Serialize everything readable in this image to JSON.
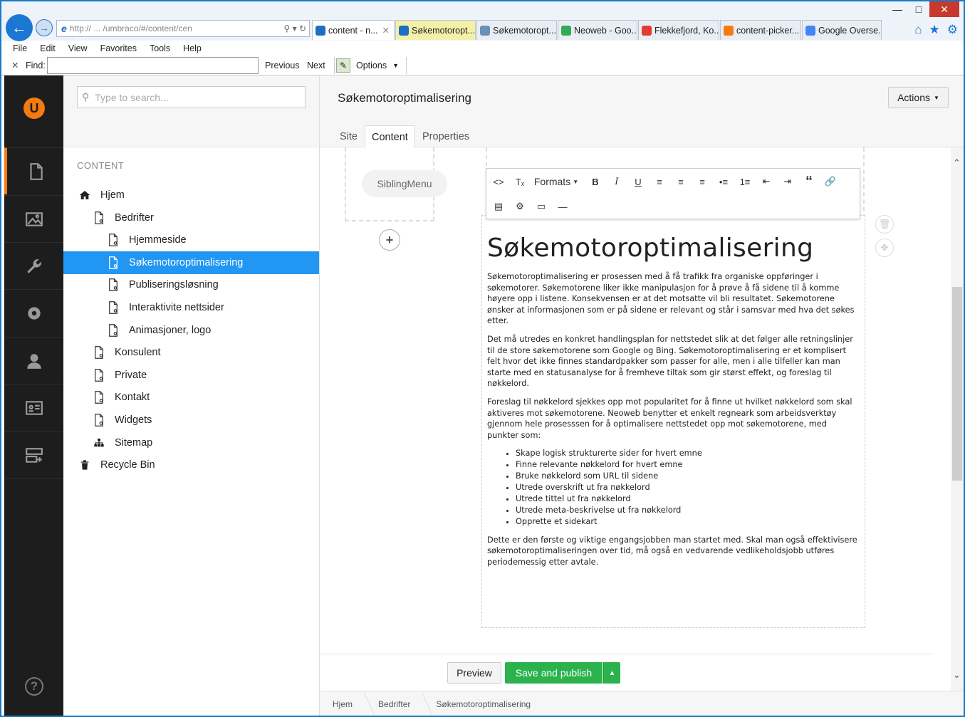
{
  "browser": {
    "address": "http:// ... /umbraco/#/content/cen",
    "tabs": [
      {
        "label": "content - n...",
        "active": true,
        "color": "#1e6fc4"
      },
      {
        "label": "Søkemotoropt...",
        "highlight": true,
        "color": "#1e6fc4"
      },
      {
        "label": "Søkemotoropt...",
        "color": "#6b8fb8"
      },
      {
        "label": "Neoweb - Goo...",
        "color": "#34a853"
      },
      {
        "label": "Flekkefjord, Ko...",
        "color": "#e53935"
      },
      {
        "label": "content-picker...",
        "color": "#f57a0f"
      },
      {
        "label": "Google Overse...",
        "color": "#4285f4"
      }
    ],
    "menu": [
      "File",
      "Edit",
      "View",
      "Favorites",
      "Tools",
      "Help"
    ],
    "find": {
      "label": "Find:",
      "value": "",
      "previous": "Previous",
      "next": "Next",
      "options": "Options"
    }
  },
  "sections": [
    "content-icon",
    "media-icon",
    "developer-icon",
    "settings-icon",
    "users-icon",
    "members-icon",
    "forms-icon"
  ],
  "tree": {
    "search_placeholder": "Type to search...",
    "title": "CONTENT",
    "nodes": [
      {
        "label": "Hjem",
        "icon": "home-icon",
        "level": 0
      },
      {
        "label": "Bedrifter",
        "icon": "document-icon",
        "level": 1
      },
      {
        "label": "Hjemmeside",
        "icon": "document-icon",
        "level": 2
      },
      {
        "label": "Søkemotoroptimalisering",
        "icon": "document-icon",
        "level": 2,
        "selected": true
      },
      {
        "label": "Publiseringsløsning",
        "icon": "document-icon",
        "level": 2
      },
      {
        "label": "Interaktivite nettsider",
        "icon": "document-icon",
        "level": 2
      },
      {
        "label": "Animasjoner, logo",
        "icon": "document-icon",
        "level": 2
      },
      {
        "label": "Konsulent",
        "icon": "document-icon",
        "level": 1
      },
      {
        "label": "Private",
        "icon": "document-icon",
        "level": 1
      },
      {
        "label": "Kontakt",
        "icon": "document-icon",
        "level": 1
      },
      {
        "label": "Widgets",
        "icon": "document-icon",
        "level": 1
      },
      {
        "label": "Sitemap",
        "icon": "sitemap-icon",
        "level": 1
      },
      {
        "label": "Recycle Bin",
        "icon": "trash-icon",
        "level": 0
      }
    ]
  },
  "editor": {
    "page_title": "Søkemotoroptimalisering",
    "actions": "Actions",
    "tabs": [
      "Site",
      "Content",
      "Properties"
    ],
    "active_tab": "Content",
    "sibling_menu": "SiblingMenu",
    "toolbar_formats": "Formats",
    "heading": "Søkemotoroptimalisering",
    "paragraphs": [
      "Søkemotoroptimalisering er prosessen med å få trafikk fra organiske oppføringer i søkemotorer. Søkemotorene liker ikke manipulasjon for å prøve å få sidene til å komme høyere opp i listene. Konsekvensen er at det motsatte vil bli resultatet. Søkemotorene ønsker at informasjonen som er på sidene er relevant og står i samsvar med hva det søkes etter.",
      "Det må utredes en konkret handlingsplan for nettstedet slik at det følger alle retningslinjer til de store søkemotorene som Google og Bing. Søkemotoroptimalisering er et komplisert felt hvor det ikke finnes standardpakker som passer for alle, men i alle tilfeller kan man starte med en statusanalyse for å fremheve tiltak som gir størst effekt, og foreslag til nøkkelord.",
      "Foreslag til nøkkelord sjekkes opp mot popularitet for å finne ut hvilket nøkkelord som skal aktiveres mot søkemotorene. Neoweb benytter et enkelt regneark som arbeidsverktøy gjennom hele prosesssen for å optimalisere nettstedet opp mot søkemotorene, med punkter som:"
    ],
    "bullets": [
      "Skape logisk strukturerte sider for hvert emne",
      "Finne relevante nøkkelord for hvert emne",
      "Bruke nøkkelord som URL til sidene",
      "Utrede overskrift ut fra nøkkelord",
      "Utrede tittel ut fra nøkkelord",
      "Utrede meta-beskrivelse ut fra nøkkelord",
      "Opprette et sidekart"
    ],
    "closing": "Dette er den første og viktige engangsjobben man startet med. Skal man også effektivisere søkemotoroptimaliseringen over tid, må også en vedvarende vedlikeholdsjobb utføres periodemessig etter avtale.",
    "preview": "Preview",
    "save": "Save and publish",
    "breadcrumbs": [
      "Hjem",
      "Bedrifter",
      "Søkemotoroptimalisering"
    ]
  },
  "colors": {
    "accent": "#f57a0f",
    "selected": "#2196f3",
    "save": "#2bb24c",
    "sidebar": "#1d1d1d"
  }
}
